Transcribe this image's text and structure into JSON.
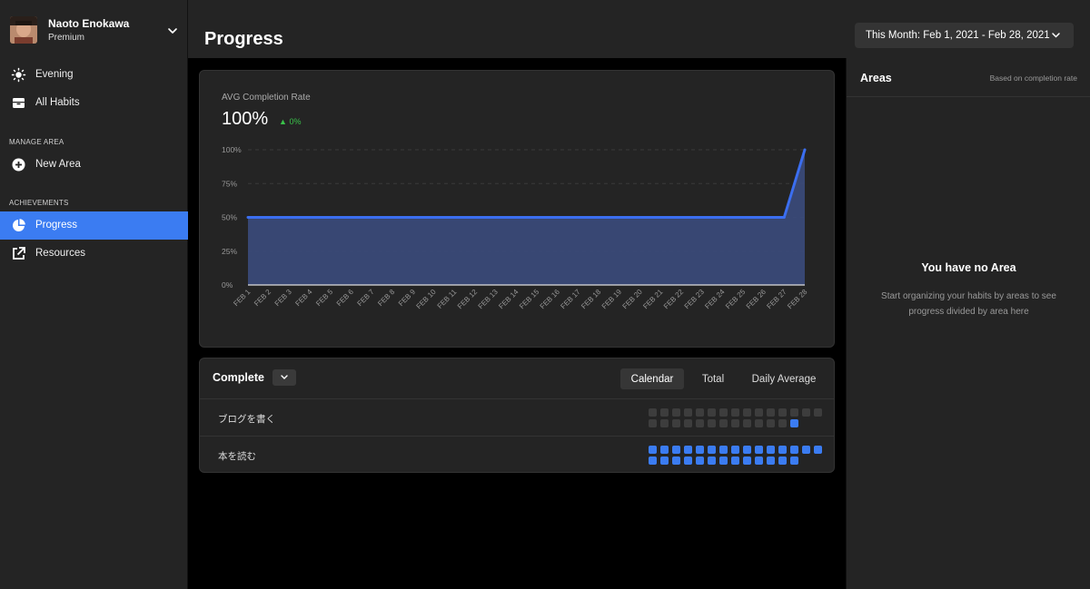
{
  "profile": {
    "name": "Naoto Enokawa",
    "plan": "Premium"
  },
  "sidebar": {
    "items": [
      {
        "label": "Evening",
        "icon": "sun-icon"
      },
      {
        "label": "All Habits",
        "icon": "inbox-icon"
      }
    ],
    "manage_area_label": "MANAGE AREA",
    "manage_items": [
      {
        "label": "New Area",
        "icon": "plus-circle-icon"
      }
    ],
    "achievements_label": "ACHIEVEMENTS",
    "achievement_items": [
      {
        "label": "Progress",
        "icon": "pie-chart-icon",
        "active": true
      },
      {
        "label": "Resources",
        "icon": "external-link-icon"
      }
    ]
  },
  "header": {
    "title": "Progress",
    "date_range": "This Month: Feb 1, 2021 - Feb 28, 2021"
  },
  "chart_card": {
    "title": "AVG Completion Rate",
    "value": "100%",
    "delta": "0%"
  },
  "chart_data": {
    "type": "area",
    "title": "AVG Completion Rate",
    "categories": [
      "FEB 1",
      "FEB 2",
      "FEB 3",
      "FEB 4",
      "FEB 5",
      "FEB 6",
      "FEB 7",
      "FEB 8",
      "FEB 9",
      "FEB 10",
      "FEB 11",
      "FEB 12",
      "FEB 13",
      "FEB 14",
      "FEB 15",
      "FEB 16",
      "FEB 17",
      "FEB 18",
      "FEB 19",
      "FEB 20",
      "FEB 21",
      "FEB 22",
      "FEB 23",
      "FEB 24",
      "FEB 25",
      "FEB 26",
      "FEB 27",
      "FEB 28"
    ],
    "values": [
      50,
      50,
      50,
      50,
      50,
      50,
      50,
      50,
      50,
      50,
      50,
      50,
      50,
      50,
      50,
      50,
      50,
      50,
      50,
      50,
      50,
      50,
      50,
      50,
      50,
      50,
      50,
      100
    ],
    "y_ticks": [
      "100%",
      "75%",
      "50%",
      "25%",
      "0%"
    ],
    "ylim": [
      0,
      100
    ],
    "grid": true,
    "color": "#3b6ef0"
  },
  "complete_card": {
    "title": "Complete",
    "tabs": [
      {
        "label": "Calendar",
        "active": true
      },
      {
        "label": "Total",
        "active": false
      },
      {
        "label": "Daily Average",
        "active": false
      }
    ],
    "habits": [
      {
        "name": "ブログを書く",
        "completed_days": [
          28
        ]
      },
      {
        "name": "本を読む",
        "completed_days": [
          1,
          2,
          3,
          4,
          5,
          6,
          7,
          8,
          9,
          10,
          11,
          12,
          13,
          14,
          15,
          16,
          17,
          18,
          19,
          20,
          21,
          22,
          23,
          24,
          25,
          26,
          27,
          28
        ]
      }
    ],
    "color_done": "#3b7cf2",
    "color_empty": "#3d3d3d"
  },
  "areas": {
    "title": "Areas",
    "note": "Based on completion rate",
    "empty_title": "You have no Area",
    "empty_desc": "Start organizing your habits by areas to see progress divided by area here"
  }
}
